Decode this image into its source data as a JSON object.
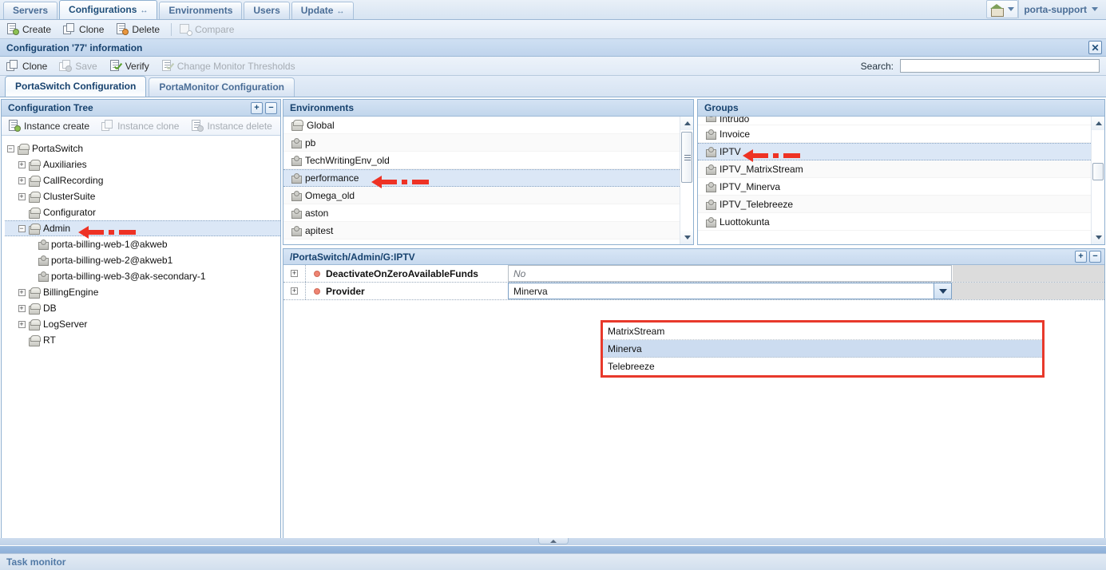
{
  "topnav": {
    "tabs": [
      {
        "label": "Servers",
        "active": false,
        "arrow": false
      },
      {
        "label": "Configurations",
        "active": true,
        "arrow": true
      },
      {
        "label": "Environments",
        "active": false,
        "arrow": false
      },
      {
        "label": "Users",
        "active": false,
        "arrow": false
      },
      {
        "label": "Update",
        "active": false,
        "arrow": true
      }
    ],
    "arrow_glyph": "↔",
    "user": "porta-support"
  },
  "main_toolbar": {
    "buttons": [
      {
        "label": "Create",
        "icon": "page-add-icon",
        "disabled": false
      },
      {
        "label": "Clone",
        "icon": "copy-icon",
        "disabled": false
      },
      {
        "label": "Delete",
        "icon": "page-delete-icon",
        "disabled": false
      },
      {
        "label": "Compare",
        "icon": "compare-icon",
        "disabled": true
      }
    ]
  },
  "config_header": {
    "title": "Configuration '77' information",
    "close_glyph": "✕"
  },
  "sub_toolbar": {
    "buttons": [
      {
        "label": "Clone",
        "icon": "copy-icon",
        "disabled": false
      },
      {
        "label": "Save",
        "icon": "save-icon",
        "disabled": true
      },
      {
        "label": "Verify",
        "icon": "verify-icon",
        "disabled": false
      },
      {
        "label": "Change Monitor Thresholds",
        "icon": "verify-icon",
        "disabled": true
      }
    ],
    "search_label": "Search:",
    "search_value": "",
    "search_placeholder": ""
  },
  "content_tabs": [
    {
      "label": "PortaSwitch Configuration",
      "active": true
    },
    {
      "label": "PortaMonitor Configuration",
      "active": false
    }
  ],
  "tree_panel": {
    "title": "Configuration Tree",
    "expand_all_label": "+",
    "collapse_all_label": "−",
    "toolbar": [
      {
        "label": "Instance create",
        "icon": "page-add-icon",
        "disabled": false
      },
      {
        "label": "Instance clone",
        "icon": "copy-icon",
        "disabled": true
      },
      {
        "label": "Instance delete",
        "icon": "page-delete-icon",
        "disabled": true
      }
    ],
    "nodes": [
      {
        "label": "PortaSwitch",
        "icon": "cube-icon",
        "depth": 0,
        "expander": "−",
        "selected": false
      },
      {
        "label": "Auxiliaries",
        "icon": "cube-icon",
        "depth": 1,
        "expander": "+",
        "selected": false
      },
      {
        "label": "CallRecording",
        "icon": "cube-icon",
        "depth": 1,
        "expander": "+",
        "selected": false
      },
      {
        "label": "ClusterSuite",
        "icon": "cube-icon",
        "depth": 1,
        "expander": "+",
        "selected": false
      },
      {
        "label": "Configurator",
        "icon": "cube-icon",
        "depth": 1,
        "expander": "",
        "selected": false
      },
      {
        "label": "Admin",
        "icon": "cube-icon",
        "depth": 1,
        "expander": "−",
        "selected": true,
        "annotated": true
      },
      {
        "label": "porta-billing-web-1@akweb",
        "icon": "puzzle-icon",
        "depth": 2,
        "expander": "",
        "selected": false
      },
      {
        "label": "porta-billing-web-2@akweb1",
        "icon": "puzzle-icon",
        "depth": 2,
        "expander": "",
        "selected": false
      },
      {
        "label": "porta-billing-web-3@ak-secondary-1",
        "icon": "puzzle-icon",
        "depth": 2,
        "expander": "",
        "selected": false
      },
      {
        "label": "BillingEngine",
        "icon": "cube-icon",
        "depth": 1,
        "expander": "+",
        "selected": false
      },
      {
        "label": "DB",
        "icon": "cube-icon",
        "depth": 1,
        "expander": "+",
        "selected": false
      },
      {
        "label": "LogServer",
        "icon": "cube-icon",
        "depth": 1,
        "expander": "+",
        "selected": false
      },
      {
        "label": "RT",
        "icon": "cube-icon",
        "depth": 1,
        "expander": "",
        "selected": false
      }
    ]
  },
  "environments_panel": {
    "title": "Environments",
    "items": [
      {
        "label": "Global",
        "icon": "cube-icon",
        "selected": false
      },
      {
        "label": "pb",
        "icon": "puzzle-icon",
        "selected": false
      },
      {
        "label": "TechWritingEnv_old",
        "icon": "puzzle-icon",
        "selected": false
      },
      {
        "label": "performance",
        "icon": "puzzle-icon",
        "selected": true,
        "annotated": true
      },
      {
        "label": "Omega_old",
        "icon": "puzzle-icon",
        "selected": false
      },
      {
        "label": "aston",
        "icon": "puzzle-icon",
        "selected": false
      },
      {
        "label": "apitest",
        "icon": "puzzle-icon",
        "selected": false
      }
    ]
  },
  "groups_panel": {
    "title": "Groups",
    "partial_top_label": "Intrudo",
    "items": [
      {
        "label": "Invoice",
        "icon": "puzzle-icon",
        "selected": false
      },
      {
        "label": "IPTV",
        "icon": "puzzle-icon",
        "selected": true,
        "annotated": true
      },
      {
        "label": "IPTV_MatrixStream",
        "icon": "puzzle-icon",
        "selected": false
      },
      {
        "label": "IPTV_Minerva",
        "icon": "puzzle-icon",
        "selected": false
      },
      {
        "label": "IPTV_Telebreeze",
        "icon": "puzzle-icon",
        "selected": false
      },
      {
        "label": "Luottokunta",
        "icon": "puzzle-icon",
        "selected": false
      }
    ]
  },
  "details_panel": {
    "path": "/PortaSwitch/Admin/G:IPTV",
    "expand_label": "+",
    "collapse_label": "−",
    "rows": [
      {
        "name": "DeactivateOnZeroAvailableFunds",
        "value": "No",
        "readonly": true,
        "expander": "+"
      },
      {
        "name": "Provider",
        "value": "Minerva",
        "readonly": false,
        "expander": "+",
        "dropdown_open": true
      }
    ],
    "dropdown": {
      "options": [
        {
          "label": "MatrixStream",
          "selected": false
        },
        {
          "label": "Minerva",
          "selected": true
        },
        {
          "label": "Telebreeze",
          "selected": false
        }
      ],
      "highlight_color": "#e8392b"
    }
  },
  "status_bar": {
    "label": "Task monitor"
  },
  "colors": {
    "accent": "#17426e",
    "selection": "#dbe7f6",
    "annotation_red": "#ee3224",
    "status_dot": "#ee8472"
  }
}
